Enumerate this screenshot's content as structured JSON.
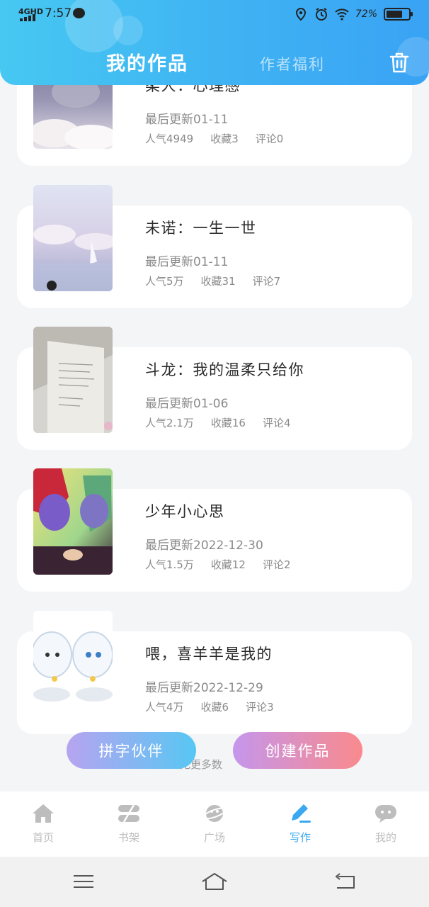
{
  "status_bar": {
    "signal": "4GHD",
    "time": "7:57",
    "battery_text": "72%",
    "battery_level": 0.72
  },
  "header": {
    "tab_active": "我的作品",
    "tab_other": "作者福利",
    "trash_icon": "trash-icon"
  },
  "works": [
    {
      "title": "柔人：心理感",
      "updated_label": "最后更新",
      "updated": "01-11",
      "popularity": "人气4949",
      "favorites": "收藏3",
      "comments": "评论0"
    },
    {
      "title": "未诺：一生一世",
      "updated_label": "最后更新",
      "updated": "01-11",
      "popularity": "人气5万",
      "favorites": "收藏31",
      "comments": "评论7"
    },
    {
      "title": "斗龙：我的温柔只给你",
      "updated_label": "最后更新",
      "updated": "01-06",
      "popularity": "人气2.1万",
      "favorites": "收藏16",
      "comments": "评论4"
    },
    {
      "title": "少年小心思",
      "updated_label": "最后更新",
      "updated": "2022-12-30",
      "popularity": "人气1.5万",
      "favorites": "收藏12",
      "comments": "评论2"
    },
    {
      "title": "喂，喜羊羊是我的",
      "updated_label": "最后更新",
      "updated": "2022-12-29",
      "popularity": "人气4万",
      "favorites": "收藏6",
      "comments": "评论3"
    }
  ],
  "footer": {
    "no_more": "无更多数",
    "partner_button": "拼字伙伴",
    "create_button": "创建作品"
  },
  "bottom_nav": [
    {
      "label": "首页",
      "icon": "home-icon",
      "active": false
    },
    {
      "label": "书架",
      "icon": "bookshelf-icon",
      "active": false
    },
    {
      "label": "广场",
      "icon": "planet-icon",
      "active": false
    },
    {
      "label": "写作",
      "icon": "pen-icon",
      "active": true
    },
    {
      "label": "我的",
      "icon": "chat-face-icon",
      "active": false
    }
  ],
  "colors": {
    "header_start": "#46c8f2",
    "header_end": "#3aa3f4",
    "active_nav": "#3aa8f0",
    "inactive_nav": "#bdbdbd"
  }
}
